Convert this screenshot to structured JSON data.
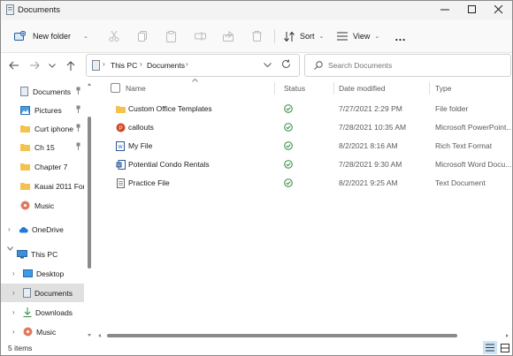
{
  "window": {
    "title": "Documents"
  },
  "toolbar": {
    "new_folder": "New folder",
    "sort": "Sort",
    "view": "View",
    "more": "…"
  },
  "address": {
    "crumbs": [
      "This PC",
      "Documents"
    ]
  },
  "search": {
    "placeholder": "Search Documents"
  },
  "sidebar": {
    "quick": [
      "Documents",
      "Pictures",
      "Curt iphone",
      "Ch 15",
      "Chapter 7",
      "Kauai 2011 For",
      "Music"
    ],
    "onedrive": "OneDrive",
    "thispc": "This PC",
    "pc_items": [
      "Desktop",
      "Documents",
      "Downloads",
      "Music"
    ]
  },
  "columns": {
    "name": "Name",
    "status": "Status",
    "date": "Date modified",
    "type": "Type"
  },
  "files": [
    {
      "name": "Custom Office Templates",
      "date": "7/27/2021 2:29 PM",
      "type": "File folder",
      "icon": "folder-icon"
    },
    {
      "name": "callouts",
      "date": "7/28/2021 10:35 AM",
      "type": "Microsoft PowerPoint...",
      "icon": "powerpoint-file-icon"
    },
    {
      "name": "My File",
      "date": "8/2/2021 8:16 AM",
      "type": "Rich Text Format",
      "icon": "rtf-file-icon"
    },
    {
      "name": "Potential Condo Rentals",
      "date": "7/28/2021 9:30 AM",
      "type": "Microsoft Word Docu...",
      "icon": "word-file-icon"
    },
    {
      "name": "Practice File",
      "date": "8/2/2021 9:25 AM",
      "type": "Text Document",
      "icon": "text-file-icon"
    }
  ],
  "statusbar": {
    "count": "5 items"
  },
  "colors": {
    "selected": "#cce4f7",
    "sync_green": "#2e8b3e",
    "folder": "#f3c34d",
    "accent": "#0067c0"
  }
}
